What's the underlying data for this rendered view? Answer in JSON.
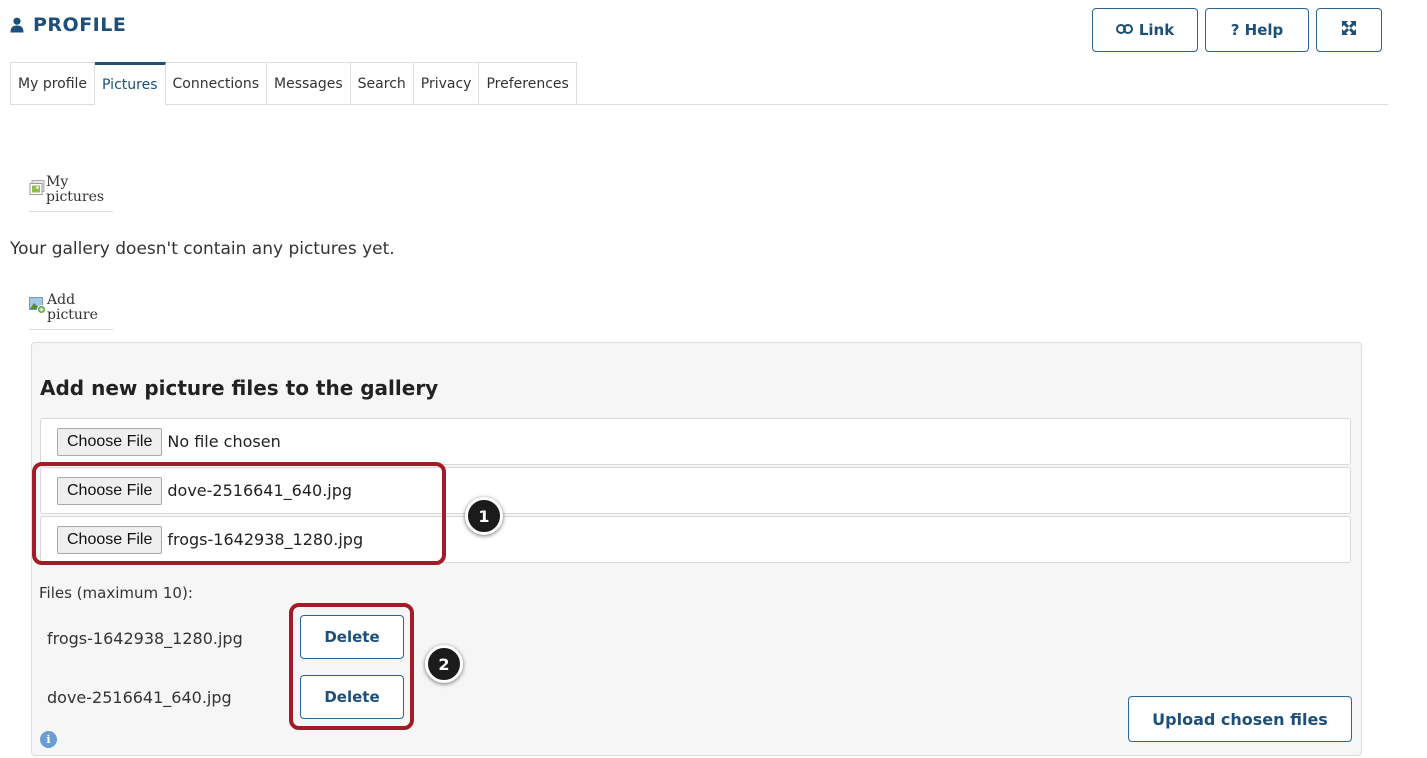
{
  "header": {
    "title": "PROFILE",
    "link_label": "Link",
    "help_label": "? Help"
  },
  "tabs": [
    {
      "label": "My profile"
    },
    {
      "label": "Pictures",
      "active": true
    },
    {
      "label": "Connections"
    },
    {
      "label": "Messages"
    },
    {
      "label": "Search"
    },
    {
      "label": "Privacy"
    },
    {
      "label": "Preferences"
    }
  ],
  "my_pictures": {
    "label_line1": "My",
    "label_line2": "pictures"
  },
  "gallery": {
    "empty_message": "Your gallery doesn't contain any pictures yet."
  },
  "add_picture": {
    "label_line1": "Add",
    "label_line2": "picture"
  },
  "upload_panel": {
    "title": "Add new picture files to the gallery",
    "file_inputs": [
      {
        "button_label": "Choose File",
        "file_name": "No file chosen"
      },
      {
        "button_label": "Choose File",
        "file_name": "dove-2516641_640.jpg"
      },
      {
        "button_label": "Choose File",
        "file_name": "frogs-1642938_1280.jpg"
      }
    ],
    "files_label": "Files (maximum 10):",
    "files": [
      {
        "name": "frogs-1642938_1280.jpg",
        "delete_label": "Delete"
      },
      {
        "name": "dove-2516641_640.jpg",
        "delete_label": "Delete"
      }
    ],
    "upload_label": "Upload chosen files",
    "info_symbol": "i"
  },
  "annotations": {
    "callout_1": "1",
    "callout_2": "2"
  },
  "icons": {
    "title": "user-icon",
    "link": "link-icon",
    "fullscreen": "expand-icon",
    "my_pictures": "pictures-icon",
    "add_picture": "add-picture-icon",
    "info": "info-icon"
  },
  "colors": {
    "accent": "#1c4f7a",
    "highlight": "#a01c28",
    "panel_bg": "#f6f6f6"
  }
}
